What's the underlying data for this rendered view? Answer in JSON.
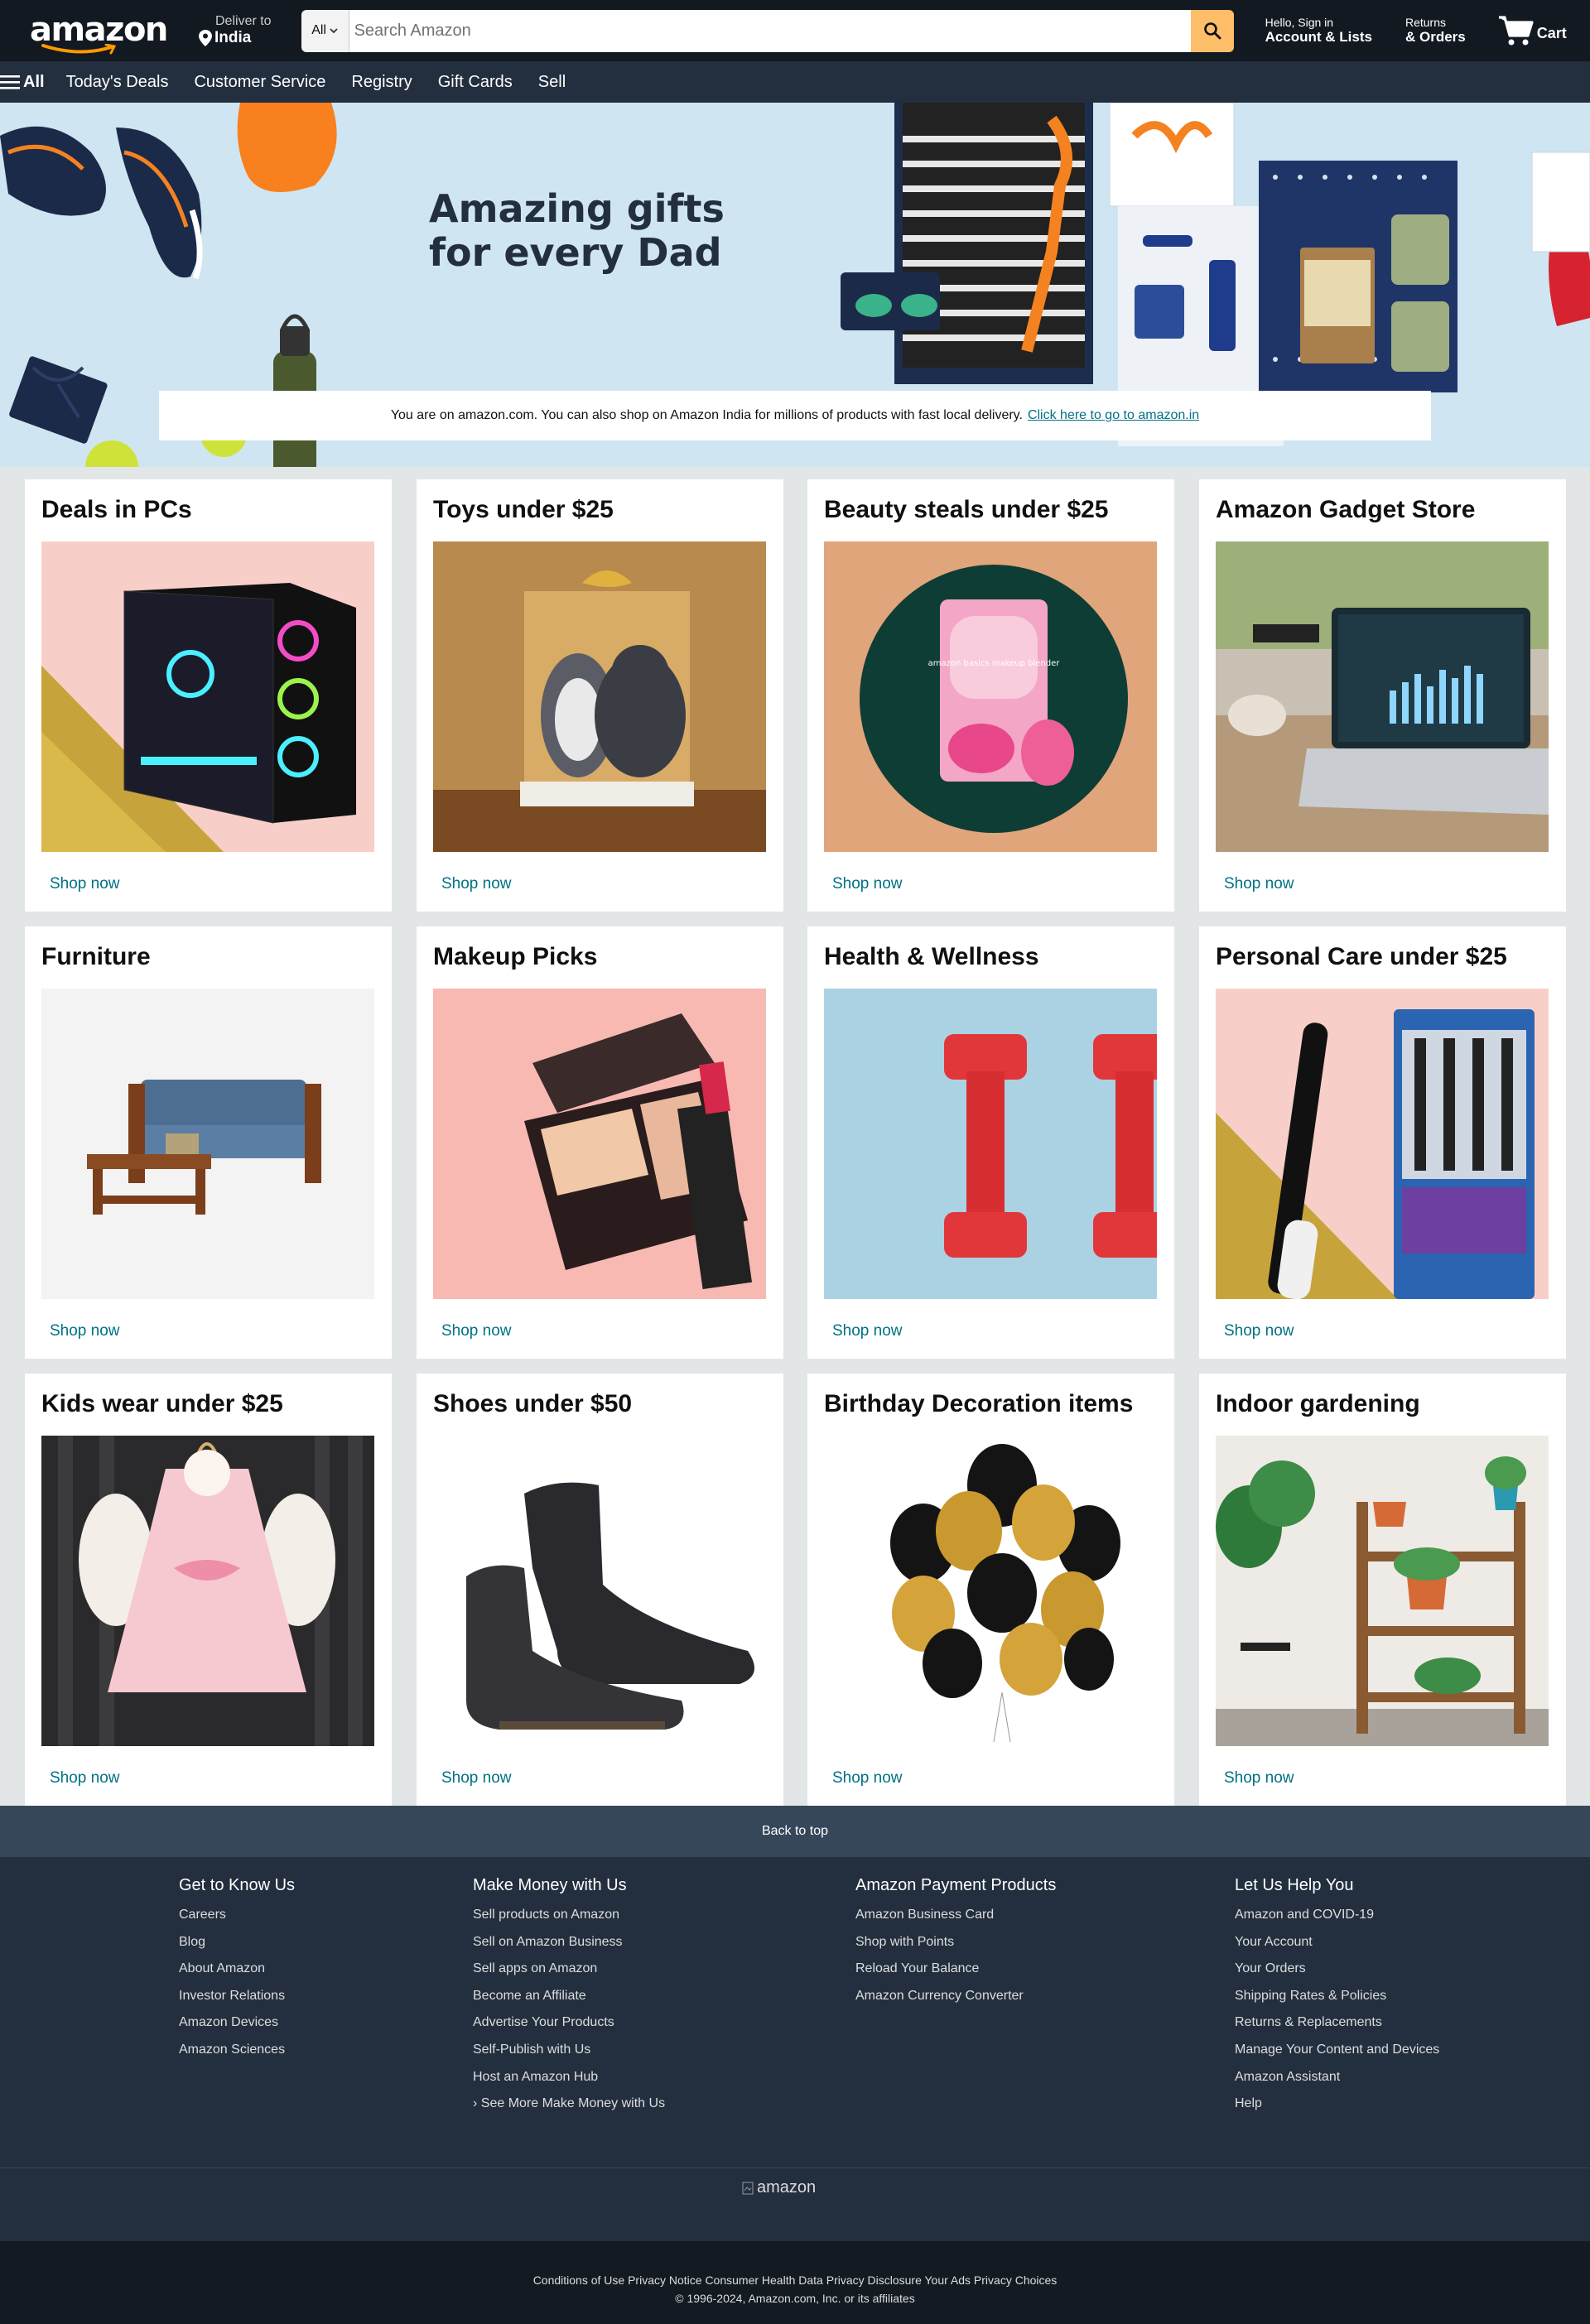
{
  "header": {
    "logo_text": "amazon",
    "deliver_label": "Deliver to",
    "deliver_location": "India",
    "search_category": "All",
    "search_placeholder": "Search Amazon",
    "account_line1": "Hello, Sign in",
    "account_line2": "Account & Lists",
    "returns_line1": "Returns",
    "returns_line2": "& Orders",
    "cart_label": "Cart",
    "icons": {
      "search": "search-icon",
      "cart": "cart-icon",
      "location": "location-pin-icon",
      "menu": "hamburger-icon"
    },
    "colors": {
      "nav_bg": "#131921",
      "subnav_bg": "#232f3e",
      "search_btn": "#febd69",
      "link": "#007185"
    }
  },
  "subnav": {
    "all_label": "All",
    "items": [
      "Today's Deals",
      "Customer Service",
      "Registry",
      "Gift Cards",
      "Sell"
    ]
  },
  "hero": {
    "title_line1": "Amazing gifts",
    "title_line2": "for every Dad",
    "notice_text": "You are on amazon.com. You can also shop on Amazon India for millions of products with fast local delivery.",
    "notice_link": "Click here to go to amazon.in"
  },
  "cards": [
    {
      "title": "Deals in PCs",
      "cta": "Shop now"
    },
    {
      "title": "Toys under $25",
      "cta": "Shop now"
    },
    {
      "title": "Beauty steals under $25",
      "cta": "Shop now",
      "product_label": "amazon basics makeup blender"
    },
    {
      "title": "Amazon Gadget Store",
      "cta": "Shop now"
    },
    {
      "title": "Furniture",
      "cta": "Shop now"
    },
    {
      "title": "Makeup Picks",
      "cta": "Shop now"
    },
    {
      "title": "Health & Wellness",
      "cta": "Shop now"
    },
    {
      "title": "Personal Care under $25",
      "cta": "Shop now"
    },
    {
      "title": "Kids wear under $25",
      "cta": "Shop now"
    },
    {
      "title": "Shoes under $50",
      "cta": "Shop now"
    },
    {
      "title": "Birthday Decoration items",
      "cta": "Shop now"
    },
    {
      "title": "Indoor gardening",
      "cta": "Shop now"
    }
  ],
  "footer": {
    "back_to_top": "Back to top",
    "columns": [
      {
        "heading": "Get to Know Us",
        "links": [
          "Careers",
          "Blog",
          "About Amazon",
          "Investor Relations",
          "Amazon Devices",
          "Amazon Sciences"
        ]
      },
      {
        "heading": "Make Money with Us",
        "links": [
          "Sell products on Amazon",
          "Sell on Amazon Business",
          "Sell apps on Amazon",
          "Become an Affiliate",
          "Advertise Your Products",
          "Self-Publish with Us",
          "Host an Amazon Hub",
          "› See More Make Money with Us"
        ]
      },
      {
        "heading": "Amazon Payment Products",
        "links": [
          "Amazon Business Card",
          "Shop with Points",
          "Reload Your Balance",
          "Amazon Currency Converter"
        ]
      },
      {
        "heading": "Let Us Help You",
        "links": [
          "Amazon and COVID-19",
          "Your Account",
          "Your Orders",
          "Shipping Rates & Policies",
          "Returns & Replacements",
          "Manage Your Content and Devices",
          "Amazon Assistant",
          "Help"
        ]
      }
    ],
    "logo_alt": "amazon",
    "legal_links": "Conditions of Use Privacy Notice Consumer Health Data Privacy Disclosure Your Ads Privacy Choices",
    "copyright": "© 1996-2024, Amazon.com, Inc. or its affiliates"
  }
}
